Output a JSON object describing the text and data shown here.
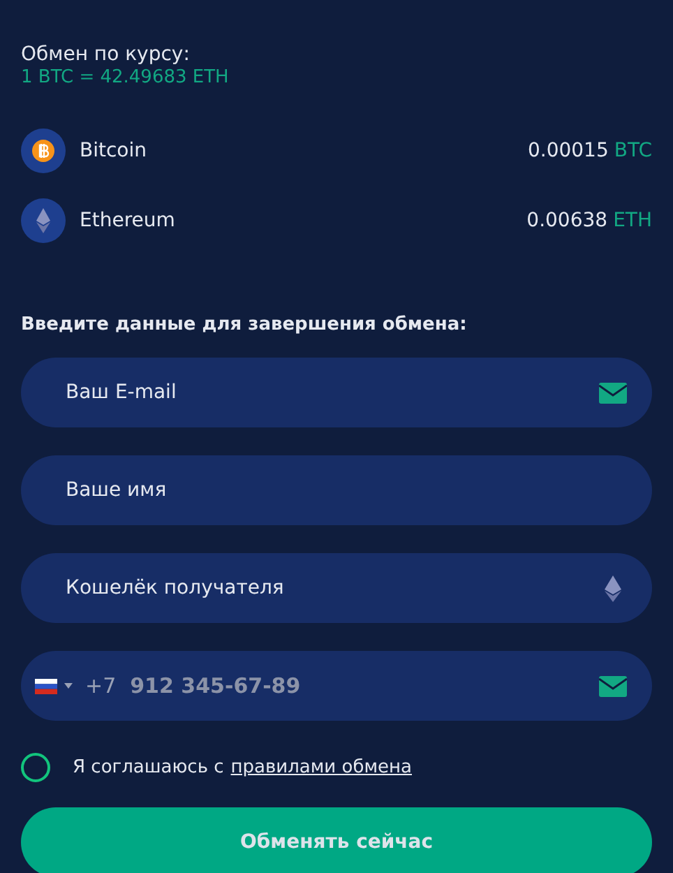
{
  "rate": {
    "label": "Обмен по курсу:",
    "value": "1 BTC = 42.49683 ETH"
  },
  "coins": [
    {
      "kind": "btc",
      "name": "Bitcoin",
      "amount": "0.00015",
      "ticker": "BTC"
    },
    {
      "kind": "eth",
      "name": "Ethereum",
      "amount": "0.00638",
      "ticker": "ETH"
    }
  ],
  "form": {
    "heading": "Введите данные для завершения обмена:",
    "fields": [
      {
        "kind": "email",
        "placeholder": "Ваш E-mail"
      },
      {
        "kind": "text",
        "placeholder": "Ваше имя"
      },
      {
        "kind": "wallet",
        "placeholder": "Кошелёк получателя"
      },
      {
        "kind": "phone",
        "prefix": "+7",
        "placeholder": "912 345-67-89"
      }
    ],
    "agreement": {
      "checked": false,
      "text": "Я соглашаюсь с",
      "link": "правилами обмена"
    },
    "submit": "Обменять сейчас"
  }
}
